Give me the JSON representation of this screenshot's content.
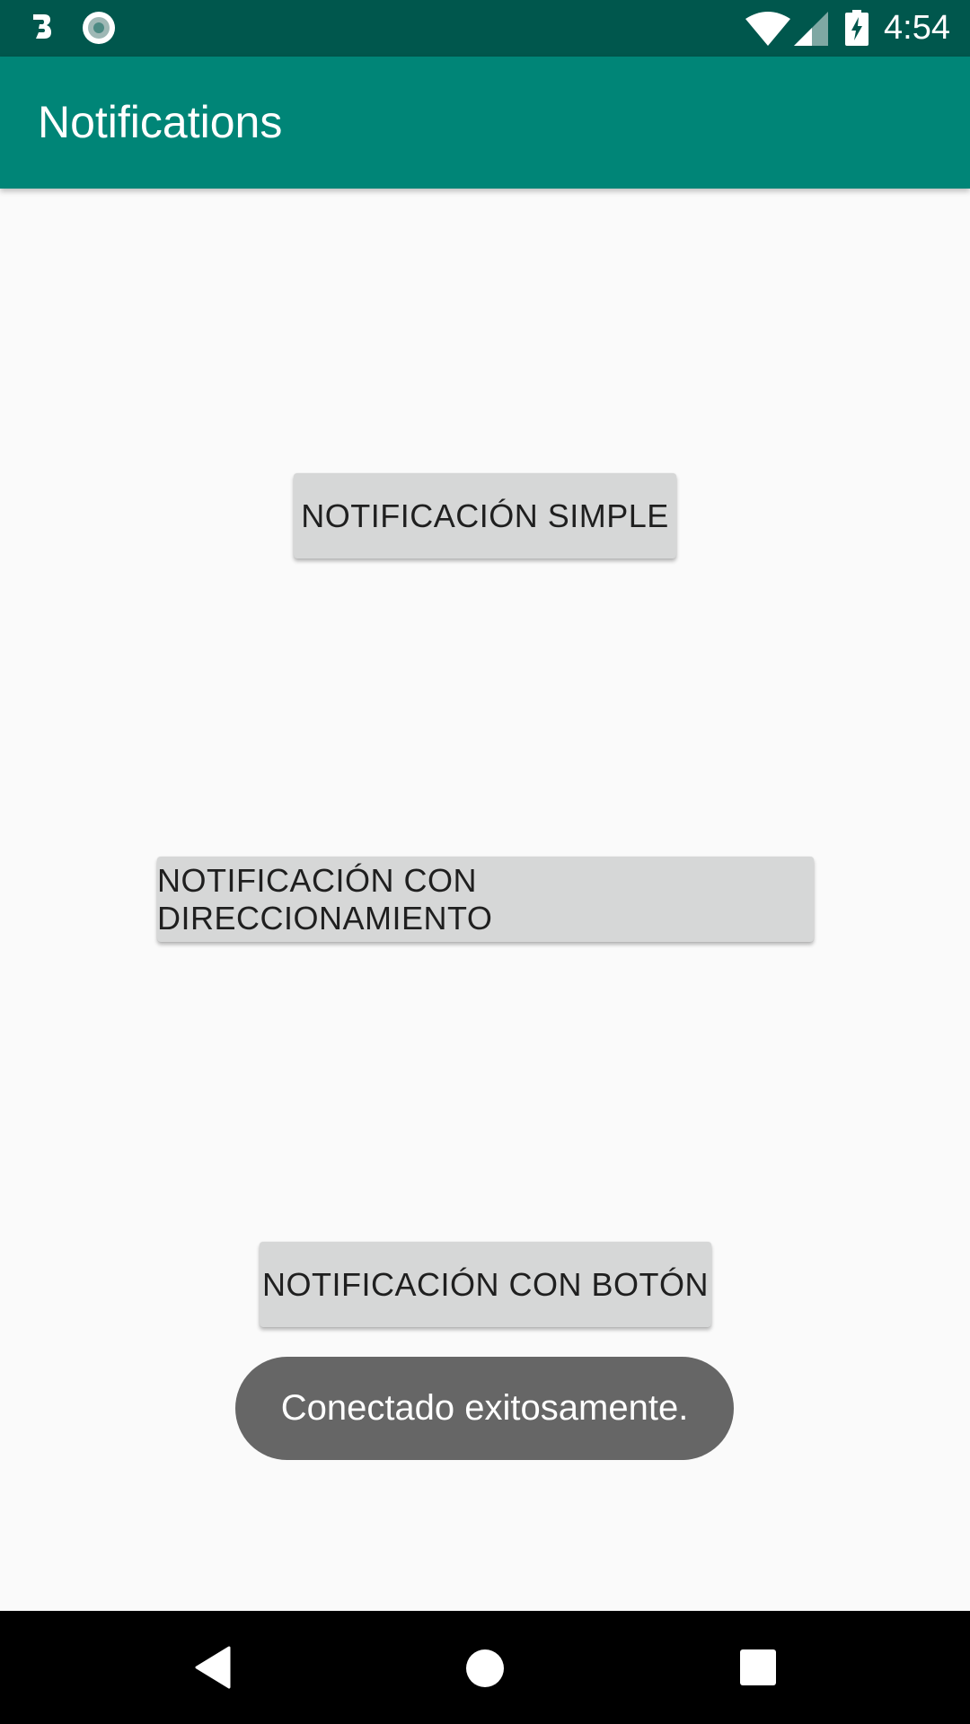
{
  "status_bar": {
    "time": "4:54",
    "icons": [
      "b-notification-icon",
      "record-notification-icon",
      "wifi-icon",
      "cell-signal-icon",
      "battery-charging-icon"
    ]
  },
  "app_bar": {
    "title": "Notifications"
  },
  "buttons": {
    "simple": "NOTIFICACIÓN SIMPLE",
    "redirect": "NOTIFICACIÓN CON DIRECCIONAMIENTO",
    "with_button": "NOTIFICACIÓN CON BOTÓN"
  },
  "toast": {
    "message": "Conectado exitosamente."
  },
  "nav_bar": {
    "icons": [
      "back-icon",
      "home-icon",
      "recents-icon"
    ]
  },
  "colors": {
    "status_bar": "#00574d",
    "app_bar": "#008577",
    "background": "#fafafa",
    "button": "#d6d7d7",
    "toast": "#666666"
  }
}
